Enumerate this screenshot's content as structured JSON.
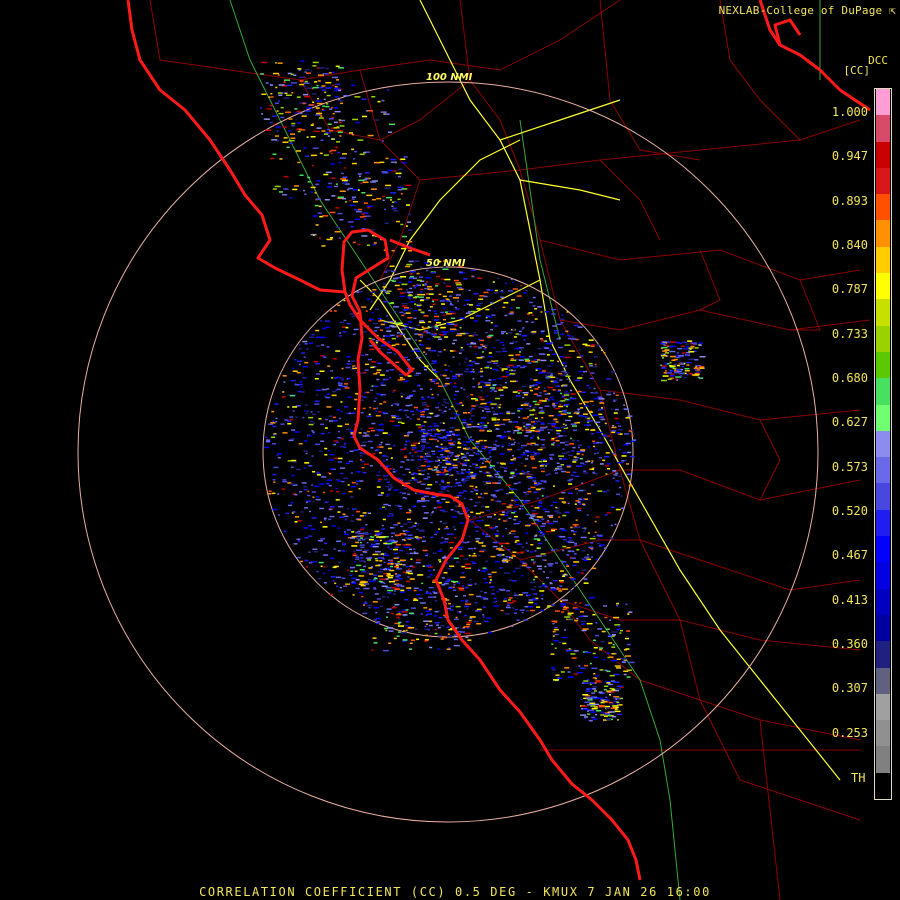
{
  "header": {
    "credit": "NEXLAB-College of DuPage",
    "credit_icon": "arrow-icon",
    "product_code": "DCC",
    "product_label": "[CC]"
  },
  "colorbar": {
    "ticks": [
      {
        "value": 1.0,
        "label": "1.000"
      },
      {
        "value": 0.947,
        "label": "0.947"
      },
      {
        "value": 0.893,
        "label": "0.893"
      },
      {
        "value": 0.84,
        "label": "0.840"
      },
      {
        "value": 0.787,
        "label": "0.787"
      },
      {
        "value": 0.733,
        "label": "0.733"
      },
      {
        "value": 0.68,
        "label": "0.680"
      },
      {
        "value": 0.627,
        "label": "0.627"
      },
      {
        "value": 0.573,
        "label": "0.573"
      },
      {
        "value": 0.52,
        "label": "0.520"
      },
      {
        "value": 0.467,
        "label": "0.467"
      },
      {
        "value": 0.413,
        "label": "0.413"
      },
      {
        "value": 0.36,
        "label": "0.360"
      },
      {
        "value": 0.307,
        "label": "0.307"
      },
      {
        "value": 0.253,
        "label": "0.253"
      }
    ],
    "th_label": "TH",
    "colors": [
      "#ff9ed4",
      "#d84a6a",
      "#c80000",
      "#d81818",
      "#ff5000",
      "#ff9000",
      "#ffcc00",
      "#ffff00",
      "#c8e000",
      "#9ad200",
      "#5cc800",
      "#48e060",
      "#70ff70",
      "#8c8cf0",
      "#6a6ae8",
      "#4848e0",
      "#1e1ef0",
      "#0000ff",
      "#0000e0",
      "#0000c0",
      "#0000a0",
      "#202080",
      "#606080",
      "#a0a0a0",
      "#909090",
      "#808080",
      "#000000"
    ]
  },
  "map": {
    "radar_site": "KMUX",
    "range_rings": [
      {
        "label": "100 NMI"
      },
      {
        "label": "50 NMI"
      }
    ]
  },
  "footer": {
    "title": "CORRELATION COEFFICIENT (CC) 0.5 DEG - KMUX 7 JAN 26 16:00"
  },
  "colors": {
    "background": "#000000",
    "state_border": "#ff1010",
    "county_border": "#a00000",
    "highway": "#ffff30",
    "secondary_road": "#40b040",
    "range_ring": "#e8b0a0",
    "text": "#f3e65a"
  }
}
